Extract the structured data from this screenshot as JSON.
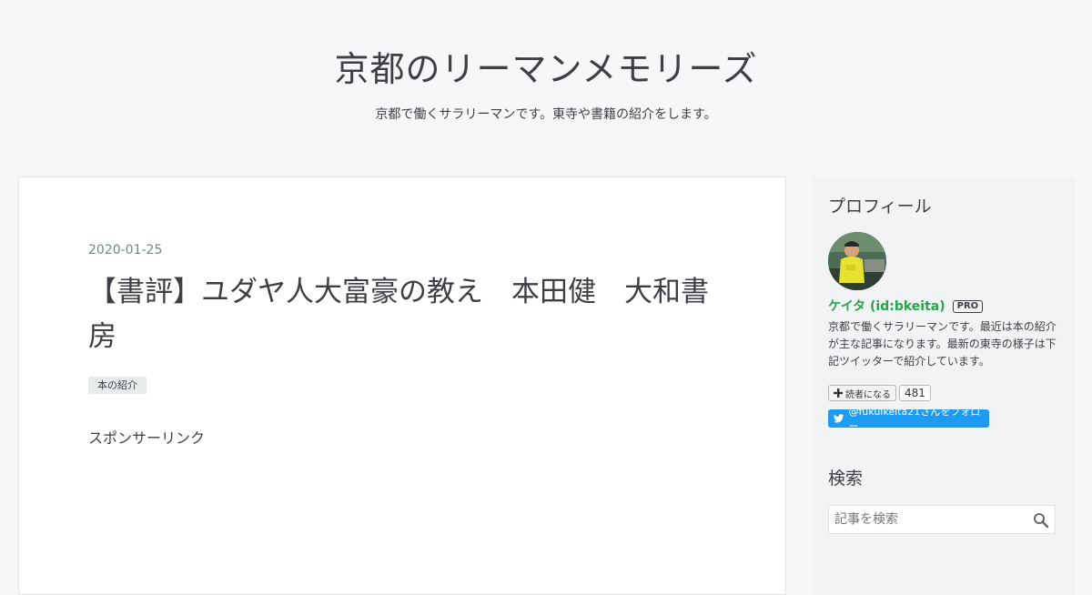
{
  "blog": {
    "title": "京都のリーマンメモリーズ",
    "description": "京都で働くサラリーマンです。東寺や書籍の紹介をします。"
  },
  "entry": {
    "date": "2020-01-25",
    "title": "【書評】ユダヤ人大富豪の教え　本田健　大和書房",
    "category": "本の紹介",
    "sponsor_label": "スポンサーリンク"
  },
  "sidebar": {
    "profile": {
      "heading": "プロフィール",
      "name": "ケイタ (id:bkeita)",
      "badge": "PRO",
      "description": "京都で働くサラリーマンです。最近は本の紹介が主な記事になります。最新の東寺の様子は下記ツイッターで紹介しています。",
      "subscribe_label": "読者になる",
      "subscriber_count": "481",
      "twitter_follow_label": "@fukuikeita21さんをフォロー"
    },
    "search": {
      "heading": "検索",
      "placeholder": "記事を検索"
    }
  },
  "colors": {
    "background": "#f6f7f8",
    "profile_name": "#27a54c",
    "twitter_button": "#1d9bf0",
    "date_text": "#758586"
  },
  "icons": [
    "plus-icon",
    "twitter-bird-icon",
    "search-icon"
  ]
}
